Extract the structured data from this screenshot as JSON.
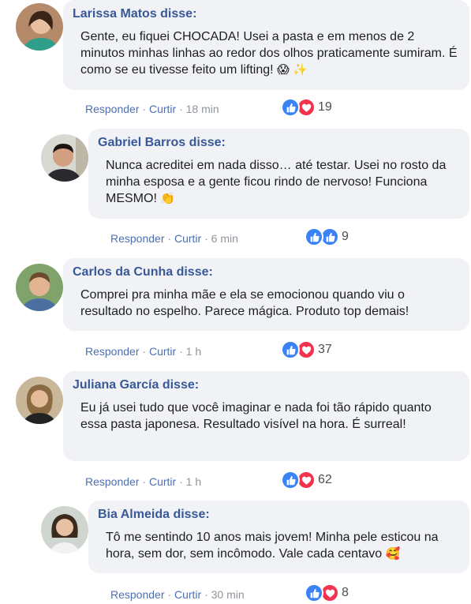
{
  "comments": [
    {
      "author": "Larissa Matos disse:",
      "text": "Gente, eu fiquei CHOCADA! Usei a pasta e em menos de 2 minutos minhas linhas ao redor dos olhos praticamente sumiram. É como se eu tivesse feito um lifting!",
      "emoji": "😱 ✨",
      "reply_label": "Responder",
      "like_label": "Curtir",
      "time": "18 min",
      "reactions": [
        "like-icon",
        "love-icon"
      ],
      "count": "19"
    },
    {
      "author": "Gabriel Barros disse:",
      "text": "Nunca acreditei em nada disso… até testar. Usei no rosto da minha esposa e a gente ficou rindo de nervoso! Funciona MESMO!",
      "emoji": "👏",
      "reply_label": "Responder",
      "like_label": "Curtir",
      "time": "6 min",
      "reactions": [
        "like-icon",
        "like-icon"
      ],
      "count": "9"
    },
    {
      "author": "Carlos da Cunha disse:",
      "text": "Comprei pra minha mãe e ela se emocionou quando viu o resultado no espelho. Parece mágica. Produto top demais!",
      "emoji": "",
      "reply_label": "Responder",
      "like_label": "Curtir",
      "time": "1 h",
      "reactions": [
        "like-icon",
        "love-icon"
      ],
      "count": "37"
    },
    {
      "author": "Juliana García disse:",
      "text": "Eu já usei tudo que você imaginar e nada foi tão rápido quanto essa pasta japonesa. Resultado visível na hora. É surreal!",
      "emoji": "",
      "reply_label": "Responder",
      "like_label": "Curtir",
      "time": "1 h",
      "reactions": [
        "like-icon",
        "love-icon"
      ],
      "count": "62"
    },
    {
      "author": "Bia Almeida disse:",
      "text": "Tô me sentindo 10 anos mais jovem! Minha pele esticou na hora, sem dor, sem incômodo. Vale cada centavo",
      "emoji": "🥰",
      "reply_label": "Responder",
      "like_label": "Curtir",
      "time": "30 min",
      "reactions": [
        "like-icon",
        "love-icon"
      ],
      "count": "8"
    }
  ],
  "separator": " · ",
  "colors": {
    "author": "#385898",
    "bubble": "#f1f2f5",
    "like": "#3b82f6",
    "love": "#f0334f",
    "link": "#4b6fb0"
  }
}
